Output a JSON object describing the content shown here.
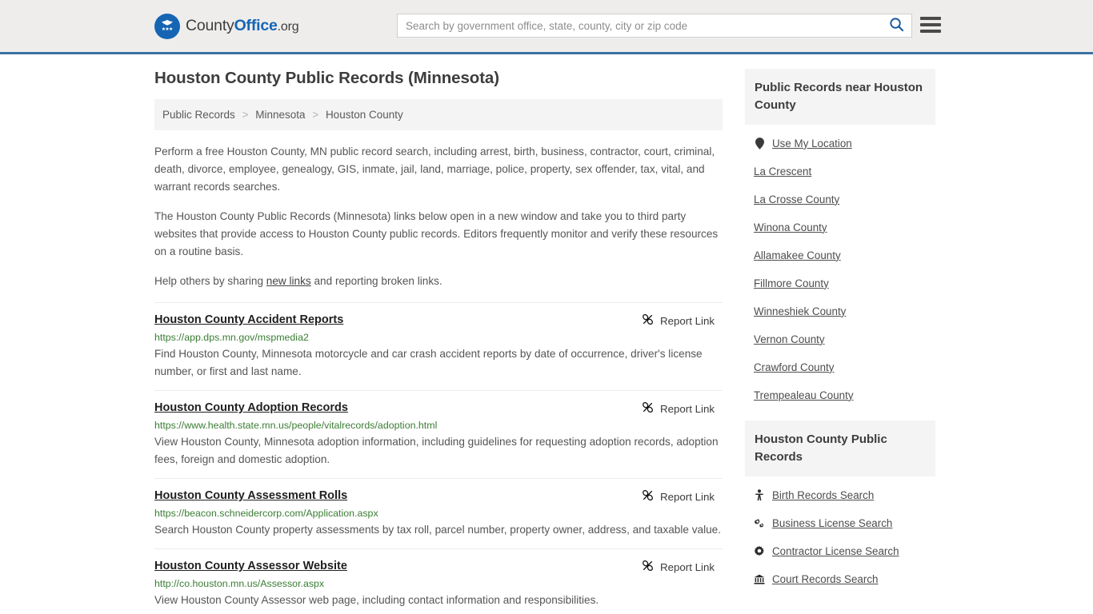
{
  "header": {
    "logo": {
      "icon": "eagle-shield-logo-icon",
      "text_part1": "County",
      "text_part2": "Office",
      "text_part3": ".org"
    },
    "search": {
      "placeholder": "Search by government office, state, county, city or zip code",
      "value": "",
      "search_icon": "search-icon"
    },
    "menu_icon": "hamburger-menu-icon",
    "accent_color": "#3c72a3",
    "background_color": "#eeedec"
  },
  "main": {
    "page_title": "Houston County Public Records (Minnesota)",
    "breadcrumb": [
      {
        "label": "Public Records"
      },
      {
        "label": "Minnesota"
      },
      {
        "label": "Houston County"
      }
    ],
    "breadcrumb_separator": ">",
    "paragraphs": [
      "Perform a free Houston County, MN public record search, including arrest, birth, business, contractor, court, criminal, death, divorce, employee, genealogy, GIS, inmate, jail, land, marriage, police, property, sex offender, tax, vital, and warrant records searches.",
      "The Houston County Public Records (Minnesota) links below open in a new window and take you to third party websites that provide access to Houston County public records. Editors frequently monitor and verify these resources on a routine basis."
    ],
    "help_text_before": "Help others by sharing ",
    "help_link": "new links",
    "help_text_after": " and reporting broken links.",
    "report_link_label": "Report Link",
    "report_link_icon": "broken-chain-icon",
    "records": [
      {
        "title": "Houston County Accident Reports",
        "url": "https://app.dps.mn.gov/mspmedia2",
        "description": "Find Houston County, Minnesota motorcycle and car crash accident reports by date of occurrence, driver's license number, or first and last name."
      },
      {
        "title": "Houston County Adoption Records",
        "url": "https://www.health.state.mn.us/people/vitalrecords/adoption.html",
        "description": "View Houston County, Minnesota adoption information, including guidelines for requesting adoption records, adoption fees, foreign and domestic adoption."
      },
      {
        "title": "Houston County Assessment Rolls",
        "url": "https://beacon.schneidercorp.com/Application.aspx",
        "description": "Search Houston County property assessments by tax roll, parcel number, property owner, address, and taxable value."
      },
      {
        "title": "Houston County Assessor Website",
        "url": "http://co.houston.mn.us/Assessor.aspx",
        "description": "View Houston County Assessor web page, including contact information and responsibilities."
      }
    ]
  },
  "sidebar": {
    "nearby": {
      "heading": "Public Records near Houston County",
      "items": [
        {
          "label": "Use My Location",
          "icon": "map-pin-icon"
        },
        {
          "label": "La Crescent",
          "icon": ""
        },
        {
          "label": "La Crosse County",
          "icon": ""
        },
        {
          "label": "Winona County",
          "icon": ""
        },
        {
          "label": "Allamakee County",
          "icon": ""
        },
        {
          "label": "Fillmore County",
          "icon": ""
        },
        {
          "label": "Winneshiek County",
          "icon": ""
        },
        {
          "label": "Vernon County",
          "icon": ""
        },
        {
          "label": "Crawford County",
          "icon": ""
        },
        {
          "label": "Trempealeau County",
          "icon": ""
        }
      ]
    },
    "county_records": {
      "heading": "Houston County Public Records",
      "items": [
        {
          "label": "Birth Records Search",
          "icon": "baby-icon"
        },
        {
          "label": "Business License Search",
          "icon": "cogs-icon"
        },
        {
          "label": "Contractor License Search",
          "icon": "cog-icon"
        },
        {
          "label": "Court Records Search",
          "icon": "courthouse-icon"
        }
      ]
    }
  }
}
